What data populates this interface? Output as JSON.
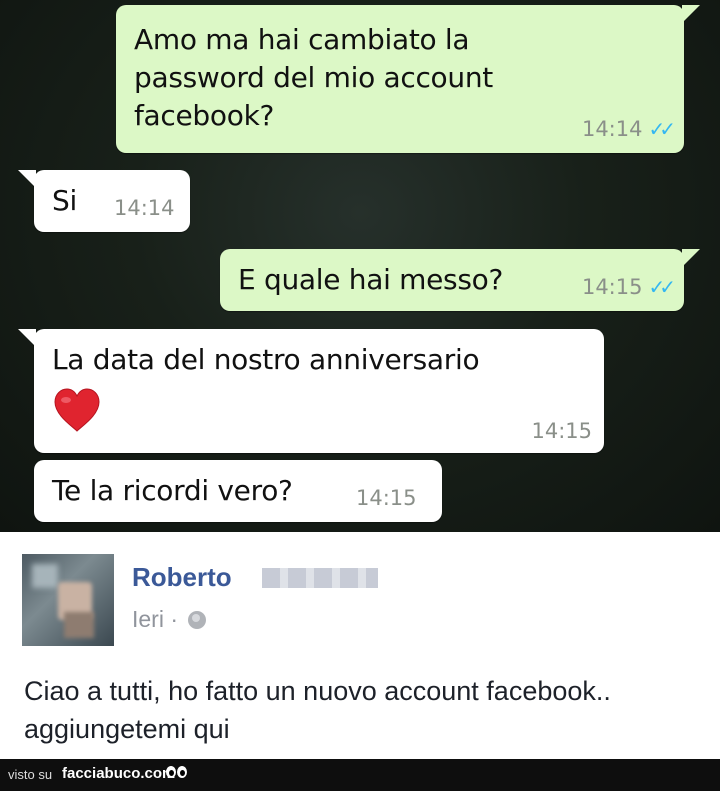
{
  "chat": {
    "messages": [
      {
        "direction": "out",
        "text": "Amo ma hai cambiato la\npassword del mio account\nfacebook?",
        "time": "14:14",
        "ticks": "✓✓"
      },
      {
        "direction": "in",
        "text": "Si",
        "time": "14:14"
      },
      {
        "direction": "out",
        "text": "E quale hai messo?",
        "time": "14:15",
        "ticks": "✓✓"
      },
      {
        "direction": "in",
        "text": "La data del nostro anniversario",
        "emoji": "heart",
        "time": "14:15"
      },
      {
        "direction": "in",
        "text": "Te la ricordi vero?",
        "time": "14:15"
      }
    ],
    "colors": {
      "outgoing": "#dcf8c6",
      "incoming": "#ffffff",
      "read_ticks": "#34b7f1"
    }
  },
  "post": {
    "author": "Roberto",
    "date": "Ieri ·",
    "privacy_icon": "globe-icon",
    "text_line1": "Ciao a tutti, ho fatto un nuovo account facebook..",
    "text_line2": "aggiungetemi qui",
    "colors": {
      "author": "#3b5998"
    }
  },
  "footer": {
    "visto": "visto su",
    "site": "facciabuco.com"
  }
}
